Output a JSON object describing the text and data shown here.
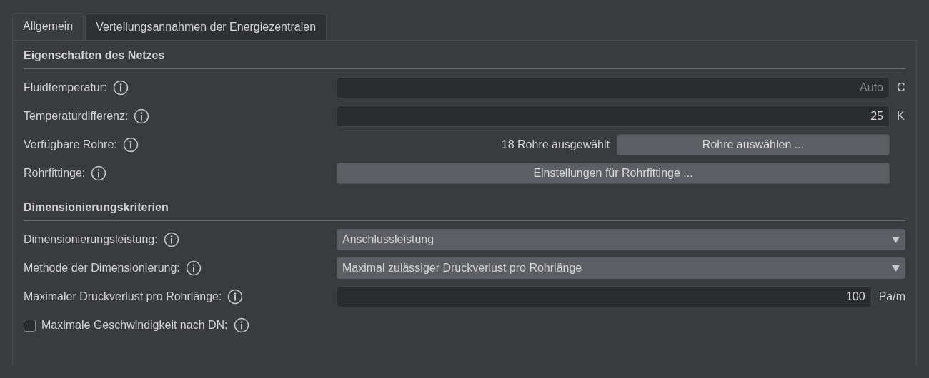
{
  "tabs": [
    {
      "label": "Allgemein",
      "selected": true
    },
    {
      "label": "Verteilungsannahmen der Energiezentralen",
      "selected": false
    }
  ],
  "sections": [
    {
      "title": "Eigenschaften des Netzes",
      "rows": [
        {
          "kind": "number",
          "label": "Fluidtemperatur:",
          "placeholder": "Auto",
          "unit": "C"
        },
        {
          "kind": "number",
          "label": "Temperaturdifferenz:",
          "value": "25",
          "unit": "K"
        },
        {
          "kind": "button-note",
          "label": "Verfügbare Rohre:",
          "note": "18 Rohre ausgewählt",
          "button": "Rohre auswählen ..."
        },
        {
          "kind": "button",
          "label": "Rohrfittinge:",
          "button": "Einstellungen für Rohrfittinge ..."
        }
      ]
    },
    {
      "title": "Dimensionierungskriterien",
      "rows": [
        {
          "kind": "dropdown",
          "label": "Dimensionierungsleistung:",
          "value": "Anschlussleistung"
        },
        {
          "kind": "dropdown",
          "label": "Methode der Dimensionierung:",
          "value": "Maximal zulässiger Druckverlust pro Rohrlänge"
        },
        {
          "kind": "number",
          "label": "Maximaler Druckverlust pro Rohrlänge:",
          "value": "100",
          "unit": "Pa/m"
        },
        {
          "kind": "checkbox",
          "label": "Maximale Geschwindigkeit nach DN:",
          "checked": false
        }
      ]
    }
  ]
}
